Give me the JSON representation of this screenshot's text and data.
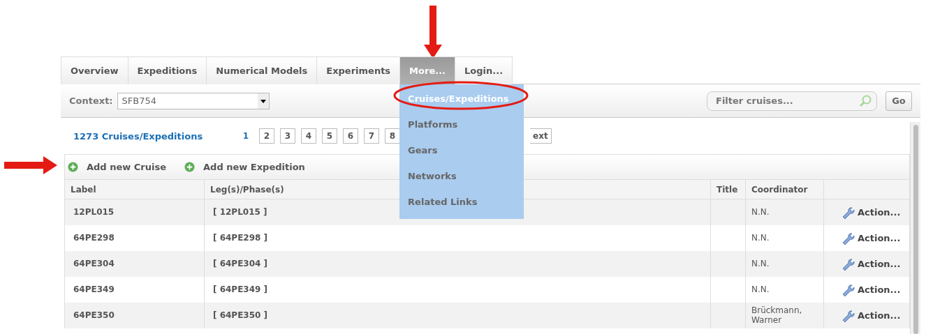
{
  "tabs": [
    {
      "label": "Overview",
      "selected": false
    },
    {
      "label": "Expeditions",
      "selected": false
    },
    {
      "label": "Numerical Models",
      "selected": false
    },
    {
      "label": "Experiments",
      "selected": false
    },
    {
      "label": "More...",
      "selected": true,
      "menu": [
        {
          "label": "Cruises/Expeditions",
          "selected": true
        },
        {
          "label": "Platforms",
          "selected": false
        },
        {
          "label": "Gears",
          "selected": false
        },
        {
          "label": "Networks",
          "selected": false
        },
        {
          "label": "Related Links",
          "selected": false
        }
      ]
    },
    {
      "label": "Login...",
      "selected": false
    }
  ],
  "context": {
    "label": "Context:",
    "value": "SFB754"
  },
  "filter": {
    "placeholder": "Filter cruises...",
    "button": "Go"
  },
  "count": "1273 Cruises/Expeditions",
  "pages": [
    {
      "label": "1",
      "selected": true
    },
    {
      "label": "2",
      "selected": false
    },
    {
      "label": "3",
      "selected": false
    },
    {
      "label": "4",
      "selected": false
    },
    {
      "label": "5",
      "selected": false
    },
    {
      "label": "6",
      "selected": false
    },
    {
      "label": "7",
      "selected": false
    },
    {
      "label": "8",
      "selected": false
    }
  ],
  "next": "ext",
  "actions": [
    "Add new Cruise",
    "Add new Expedition"
  ],
  "table": {
    "columns": [
      "Label",
      "Leg(s)/Phase(s)",
      "Title",
      "Coordinator"
    ],
    "rows": [
      {
        "label": "12PL015",
        "legs": "[ 12PL015 ]",
        "coordinator": "N.N.",
        "action": "Action..."
      },
      {
        "label": "64PE298",
        "legs": "[ 64PE298 ]",
        "coordinator": "N.N.",
        "action": "Action..."
      },
      {
        "label": "64PE304",
        "legs": "[ 64PE304 ]",
        "coordinator": "N.N.",
        "action": "Action..."
      },
      {
        "label": "64PE349",
        "legs": "[ 64PE349 ]",
        "coordinator": "N.N.",
        "action": "Action..."
      },
      {
        "label": "64PE350",
        "legs": "[ 64PE350 ]",
        "coordinator": "Brückmann, Warner",
        "action": "Action..."
      }
    ]
  }
}
